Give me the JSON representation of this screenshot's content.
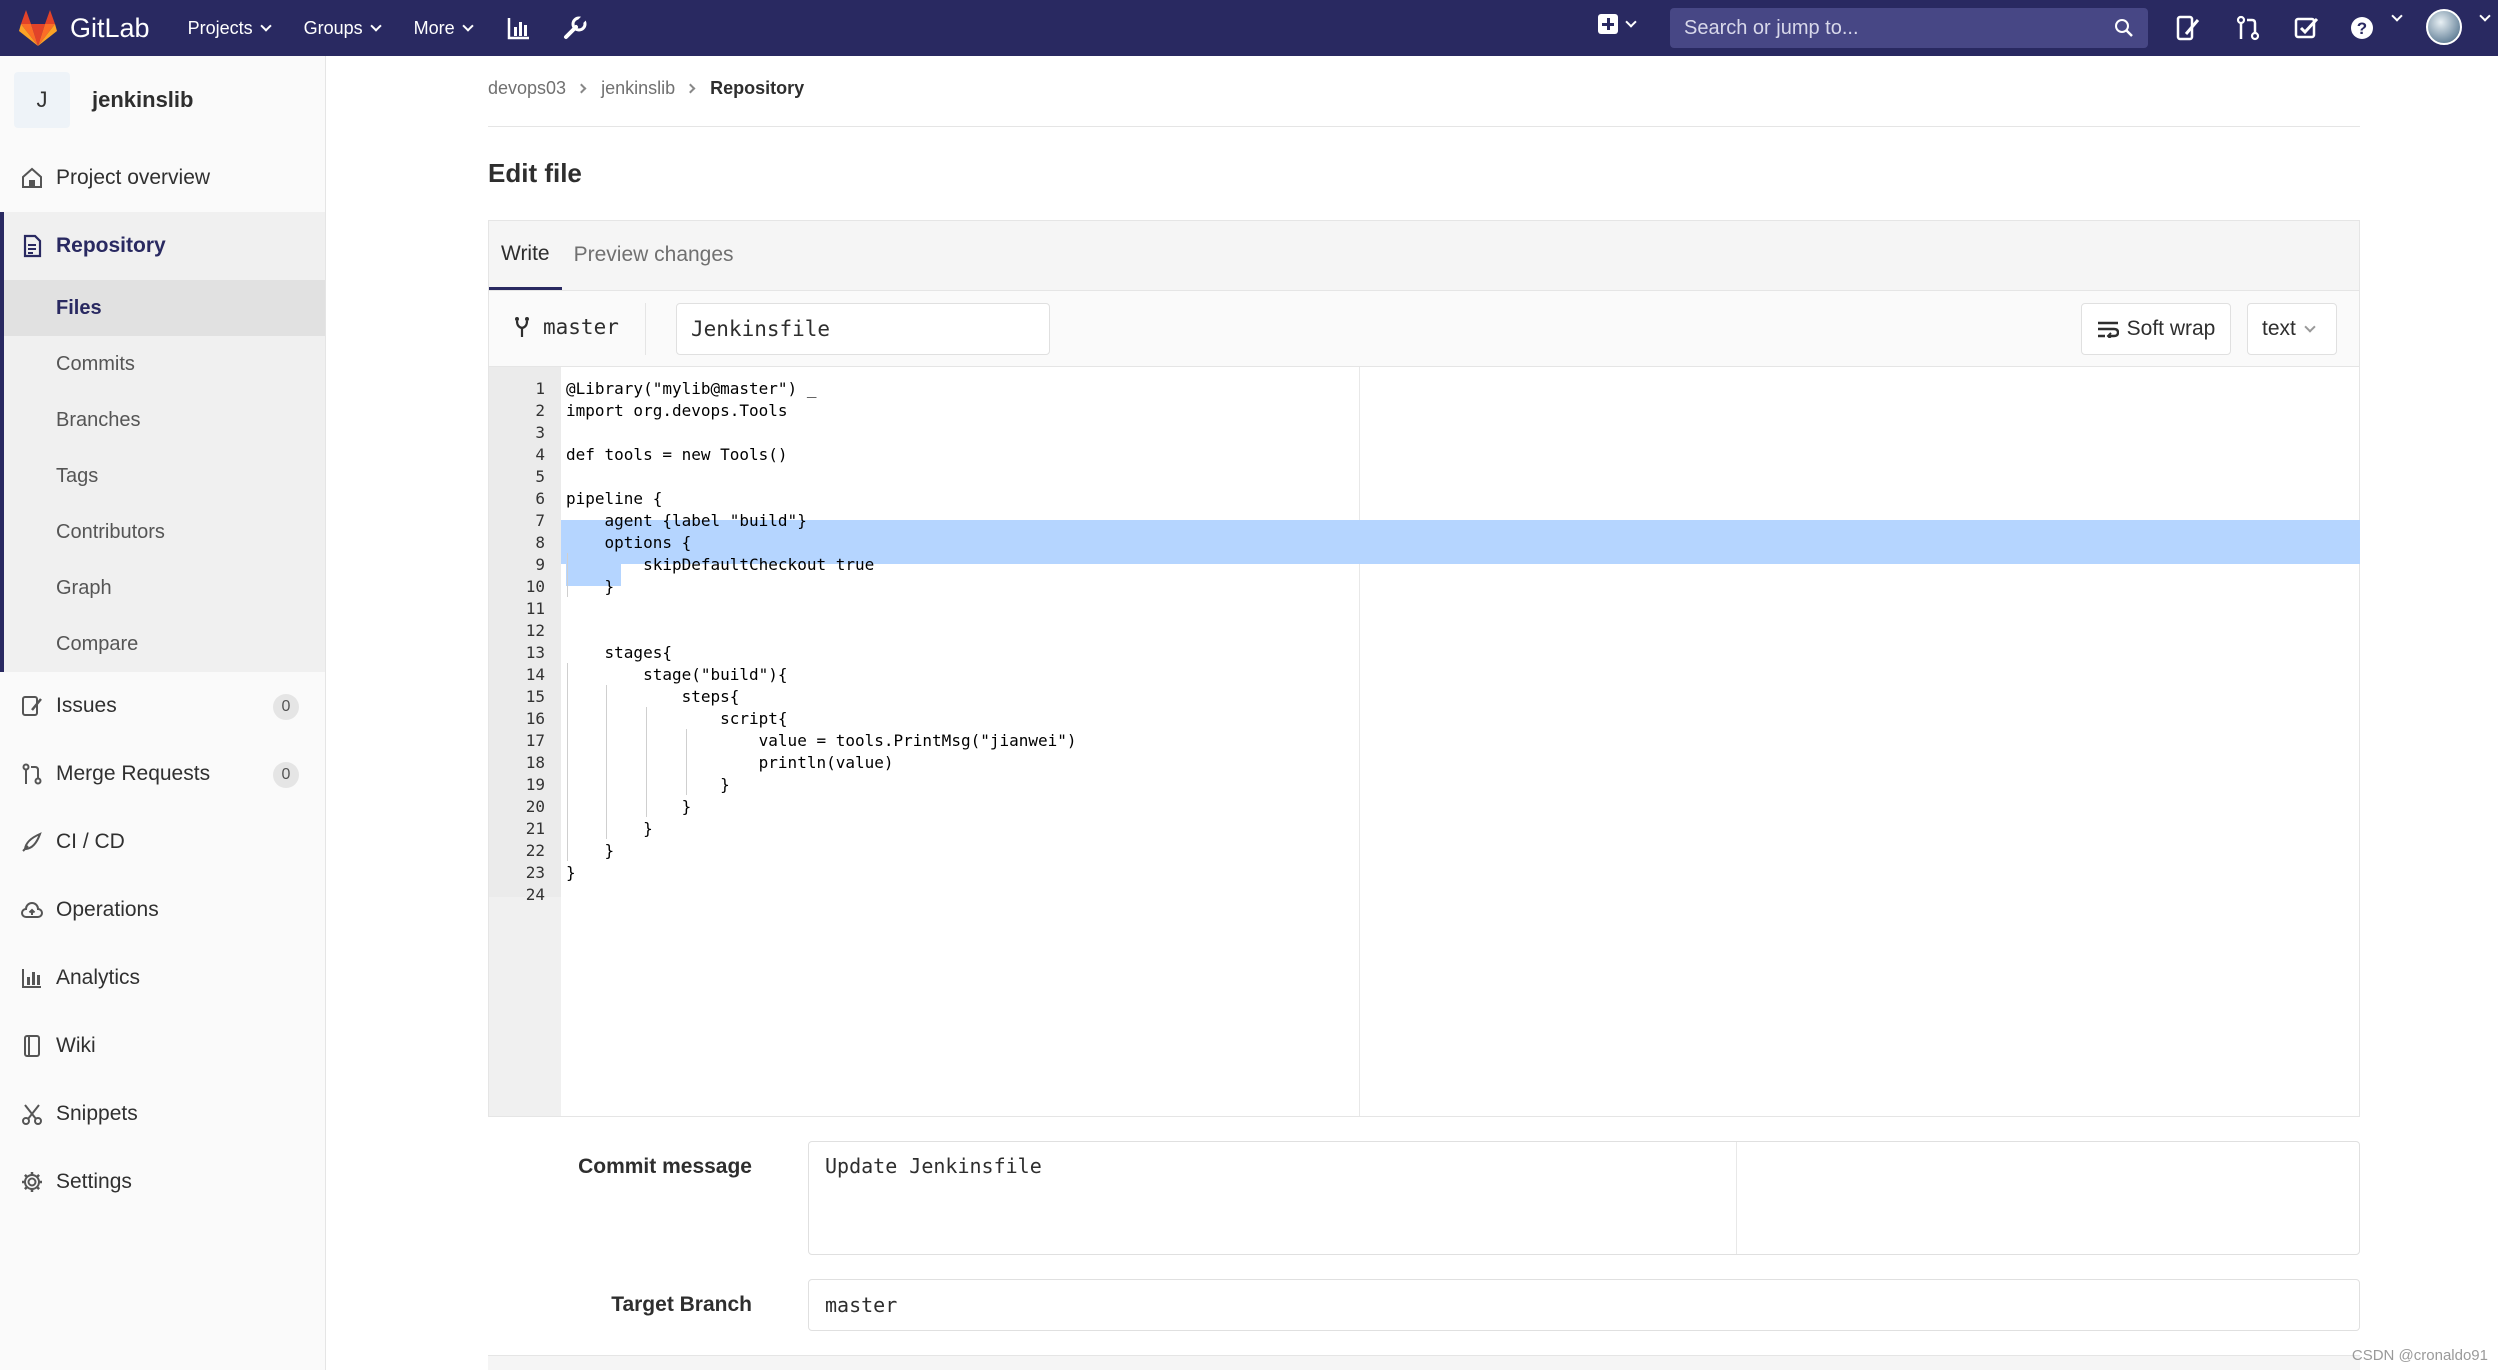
{
  "navbar": {
    "brand": "GitLab",
    "menu": [
      "Projects",
      "Groups",
      "More"
    ],
    "search_placeholder": "Search or jump to...",
    "icons": [
      "activity-chart-icon",
      "wrench-icon",
      "plus-square-icon",
      "todo-icon",
      "merge-request-icon",
      "issue-check-icon",
      "help-icon"
    ],
    "background": "#292961"
  },
  "sidebar": {
    "project_initial": "J",
    "project_name": "jenkinslib",
    "items": [
      {
        "label": "Project overview",
        "icon": "home-icon"
      },
      {
        "label": "Repository",
        "icon": "document-icon",
        "active": true
      },
      {
        "label": "Issues",
        "icon": "issues-icon",
        "count": "0"
      },
      {
        "label": "Merge Requests",
        "icon": "merge-request-icon",
        "count": "0"
      },
      {
        "label": "CI / CD",
        "icon": "rocket-icon"
      },
      {
        "label": "Operations",
        "icon": "cloud-icon"
      },
      {
        "label": "Analytics",
        "icon": "chart-icon"
      },
      {
        "label": "Wiki",
        "icon": "book-icon"
      },
      {
        "label": "Snippets",
        "icon": "scissors-icon"
      },
      {
        "label": "Settings",
        "icon": "gear-icon"
      }
    ],
    "repo_subitems": [
      {
        "label": "Files",
        "active": true
      },
      {
        "label": "Commits"
      },
      {
        "label": "Branches"
      },
      {
        "label": "Tags"
      },
      {
        "label": "Contributors"
      },
      {
        "label": "Graph"
      },
      {
        "label": "Compare"
      }
    ]
  },
  "breadcrumb": [
    "devops03",
    "jenkinslib",
    "Repository"
  ],
  "page_title": "Edit file",
  "editor": {
    "tabs": [
      "Write",
      "Preview changes"
    ],
    "branch": "master",
    "file_name": "Jenkinsfile",
    "soft_wrap_label": "Soft wrap",
    "mode": "text",
    "selection_color": "#b5d5ff",
    "lines": [
      "@Library(\"mylib@master\") _",
      "import org.devops.Tools",
      "",
      "def tools = new Tools()",
      "",
      "pipeline {",
      "    agent {label \"build\"}",
      "    options {",
      "        skipDefaultCheckout true",
      "    }",
      "",
      "",
      "    stages{",
      "        stage(\"build\"){",
      "            steps{",
      "                script{",
      "                    value = tools.PrintMsg(\"jianwei\")",
      "                    println(value)",
      "                }",
      "            }",
      "        }",
      "    }",
      "}",
      ""
    ]
  },
  "form": {
    "commit_label": "Commit message",
    "commit_value": "Update Jenkinsfile",
    "target_label": "Target Branch",
    "target_value": "master"
  },
  "watermark": "CSDN @cronaldo91"
}
